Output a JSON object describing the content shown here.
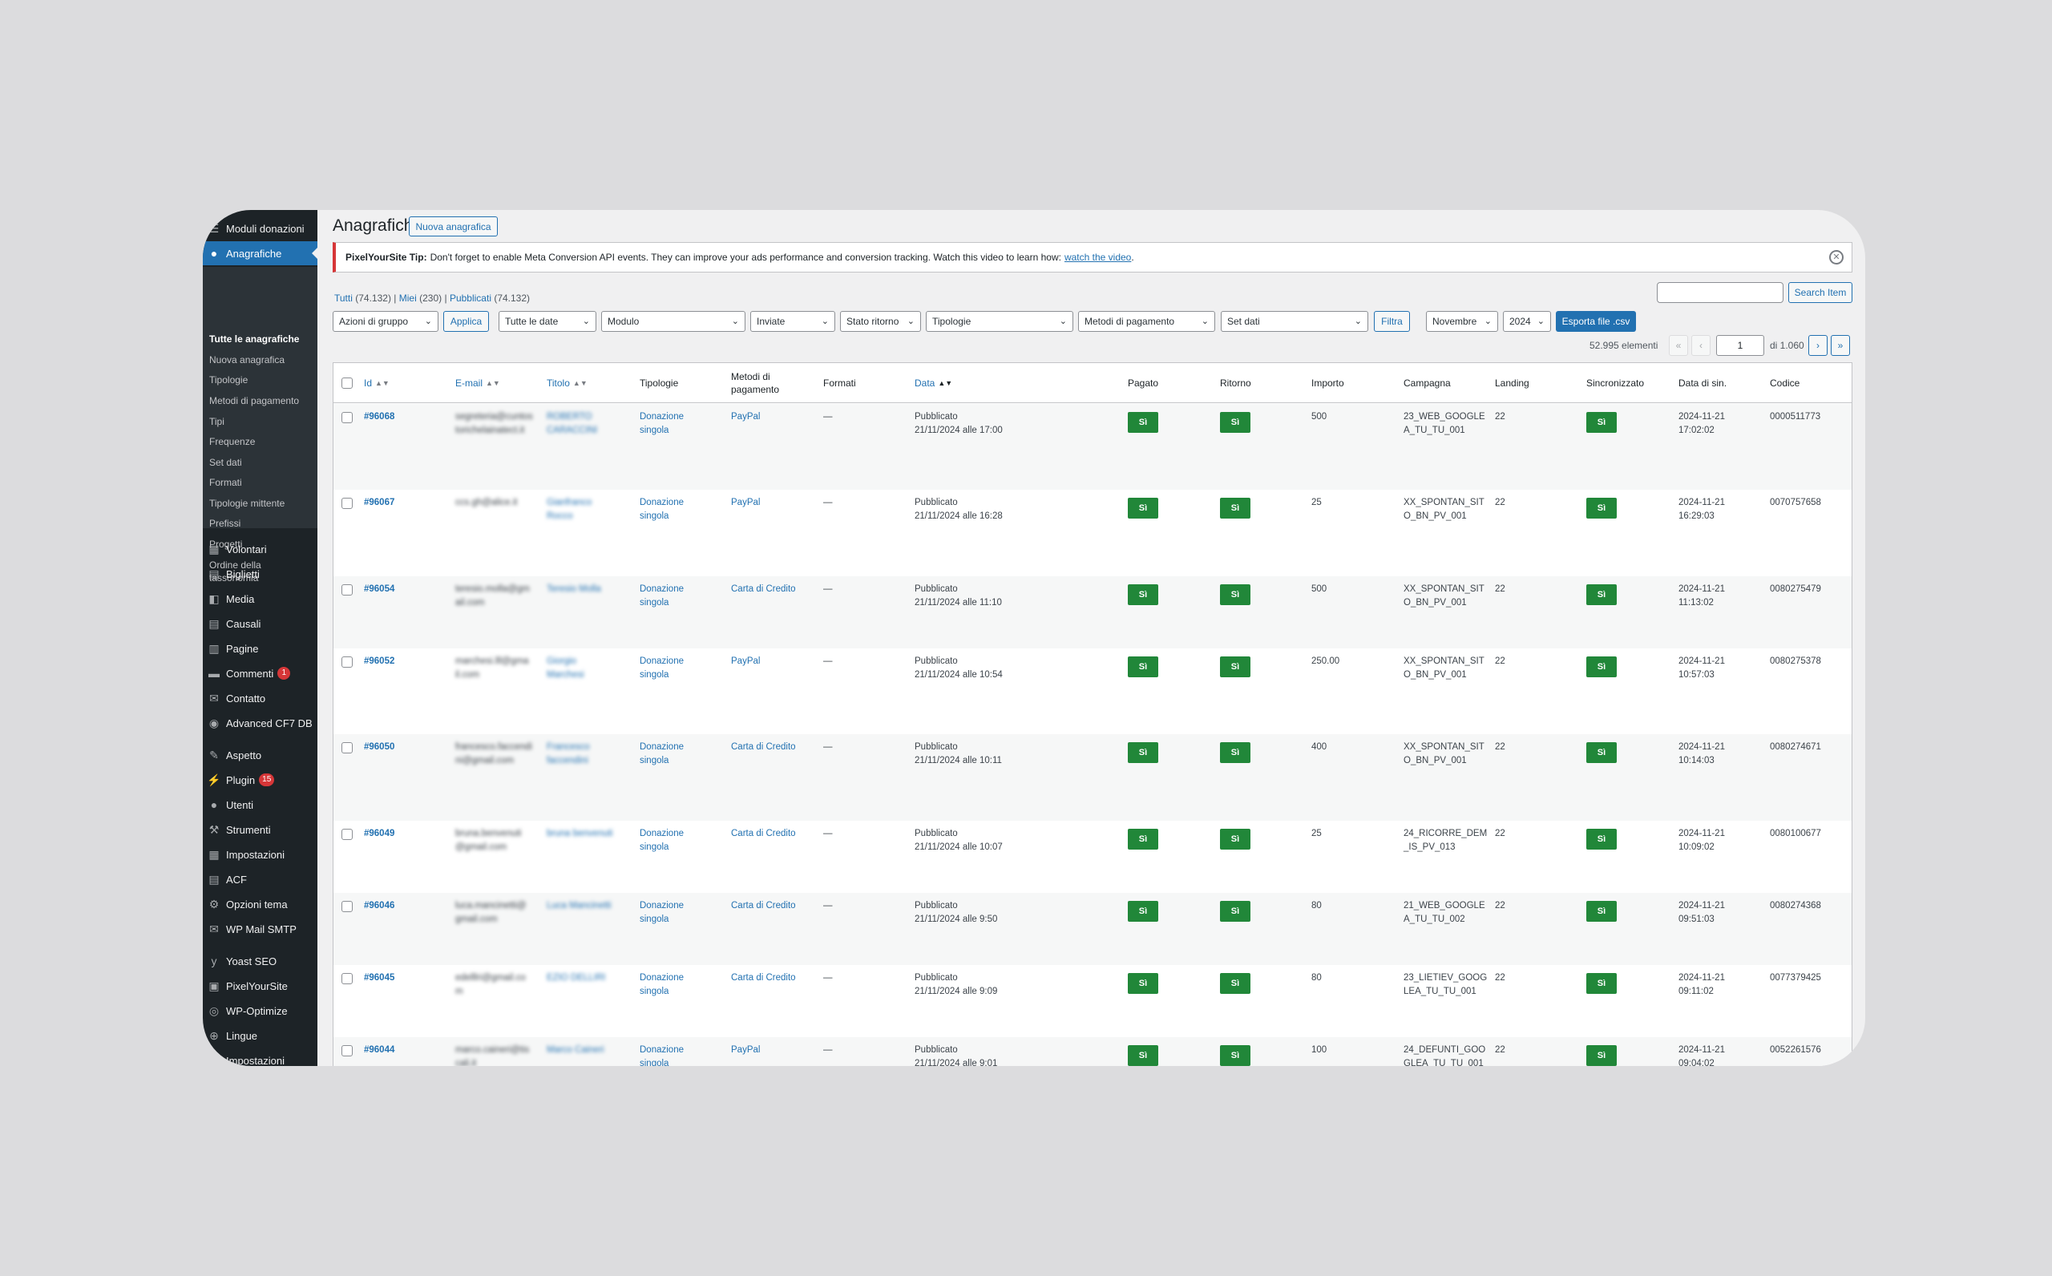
{
  "sidebar": {
    "top_item": "Moduli donazioni",
    "active_item": "Anagrafiche",
    "submenu": [
      "Tutte le anagrafiche",
      "Nuova anagrafica",
      "Tipologie",
      "Metodi di pagamento",
      "Tipi",
      "Frequenze",
      "Set dati",
      "Formati",
      "Tipologie mittente",
      "Prefissi",
      "Progetti",
      "Ordine della",
      "tassonomia"
    ],
    "items": [
      "Volontari",
      "Biglietti",
      "Media",
      "Causali",
      "Pagine",
      "Commenti",
      "Contatto",
      "Advanced CF7 DB",
      "Aspetto",
      "Plugin",
      "Utenti",
      "Strumenti",
      "Impostazioni",
      "ACF",
      "Opzioni tema",
      "WP Mail SMTP",
      "Yoast SEO",
      "PixelYourSite",
      "WP-Optimize",
      "Lingue",
      "Impostazioni"
    ],
    "badges": {
      "comments": "1",
      "plugins": "15"
    }
  },
  "header": {
    "title": "Anagrafiche",
    "new_button": "Nuova anagrafica"
  },
  "notice": {
    "brand": "PixelYourSite Tip:",
    "text": "Don't forget to enable Meta Conversion API events. They can improve your ads performance and conversion tracking. Watch this video to learn how:",
    "link": "watch the video",
    "period": "."
  },
  "views": {
    "all": "Tutti",
    "all_count": "(74.132)",
    "mine": "Miei",
    "mine_count": "(230)",
    "published": "Pubblicati",
    "published_count": "(74.132)",
    "sep": "|"
  },
  "search": {
    "button": "Search Item",
    "value": ""
  },
  "filters": {
    "bulk": "Azioni di gruppo",
    "apply": "Applica",
    "dates": "Tutte le date",
    "module": "Modulo",
    "sent": "Inviate",
    "return_status": "Stato ritorno",
    "types": "Tipologie",
    "payment_methods": "Metodi di pagamento",
    "dataset": "Set dati",
    "filter": "Filtra",
    "month": "Novembre",
    "year": "2024",
    "export": "Esporta file .csv"
  },
  "pagination": {
    "items": "52.995 elementi",
    "first": "«",
    "prev": "‹",
    "current": "1",
    "of": "di 1.060",
    "next": "›",
    "last": "»"
  },
  "columns": {
    "id": "Id",
    "email": "E-mail",
    "title": "Titolo",
    "types": "Tipologie",
    "payment1": "Metodi di",
    "payment2": "pagamento",
    "formats": "Formati",
    "date": "Data",
    "paid": "Pagato",
    "return": "Ritorno",
    "amount": "Importo",
    "campaign": "Campagna",
    "landing": "Landing",
    "synced": "Sincronizzato",
    "sync_date": "Data di sin.",
    "code": "Codice"
  },
  "rows": [
    {
      "id": "#96068",
      "email1": "segreteria@cuntos",
      "email2": "torichelainatect.it",
      "title1": "ROBERTO",
      "title2": "CARACCINI",
      "type1": "Donazione",
      "type2": "singola",
      "payment": "PayPal",
      "formats": "—",
      "status": "Pubblicato",
      "date": "21/11/2024 alle 17:00",
      "paid": "Sì",
      "ret": "Sì",
      "amount": "500",
      "camp1": "23_WEB_GOOGLE",
      "camp2": "A_TU_TU_001",
      "landing": "22",
      "synced": "Sì",
      "sd1": "2024-11-21",
      "sd2": "17:02:02",
      "code": "0000511773"
    },
    {
      "id": "#96067",
      "email1": "ccs.gh@alice.it",
      "email2": "",
      "title1": "Gianfranco",
      "title2": "Rocco",
      "type1": "Donazione",
      "type2": "singola",
      "payment": "PayPal",
      "formats": "—",
      "status": "Pubblicato",
      "date": "21/11/2024 alle 16:28",
      "paid": "Sì",
      "ret": "Sì",
      "amount": "25",
      "camp1": "XX_SPONTAN_SIT",
      "camp2": "O_BN_PV_001",
      "landing": "22",
      "synced": "Sì",
      "sd1": "2024-11-21",
      "sd2": "16:29:03",
      "code": "0070757658"
    },
    {
      "id": "#96054",
      "email1": "teresio.molla@gm",
      "email2": "ail.com",
      "title1": "Teresio Molla",
      "title2": "",
      "type1": "Donazione",
      "type2": "singola",
      "payment": "Carta di Credito",
      "formats": "—",
      "status": "Pubblicato",
      "date": "21/11/2024 alle 11:10",
      "paid": "Sì",
      "ret": "Sì",
      "amount": "500",
      "camp1": "XX_SPONTAN_SIT",
      "camp2": "O_BN_PV_001",
      "landing": "22",
      "synced": "Sì",
      "sd1": "2024-11-21",
      "sd2": "11:13:02",
      "code": "0080275479"
    },
    {
      "id": "#96052",
      "email1": "marchesi.lll@gma",
      "email2": "il.com",
      "title1": "Giorgio",
      "title2": "Marchesi",
      "type1": "Donazione",
      "type2": "singola",
      "payment": "PayPal",
      "formats": "—",
      "status": "Pubblicato",
      "date": "21/11/2024 alle 10:54",
      "paid": "Sì",
      "ret": "Sì",
      "amount": "250.00",
      "camp1": "XX_SPONTAN_SIT",
      "camp2": "O_BN_PV_001",
      "landing": "22",
      "synced": "Sì",
      "sd1": "2024-11-21",
      "sd2": "10:57:03",
      "code": "0080275378"
    },
    {
      "id": "#96050",
      "email1": "francesco.faccendi",
      "email2": "ni@gmail.com",
      "title1": "Francesco",
      "title2": "faccendini",
      "type1": "Donazione",
      "type2": "singola",
      "payment": "Carta di Credito",
      "formats": "—",
      "status": "Pubblicato",
      "date": "21/11/2024 alle 10:11",
      "paid": "Sì",
      "ret": "Sì",
      "amount": "400",
      "camp1": "XX_SPONTAN_SIT",
      "camp2": "O_BN_PV_001",
      "landing": "22",
      "synced": "Sì",
      "sd1": "2024-11-21",
      "sd2": "10:14:03",
      "code": "0080274671"
    },
    {
      "id": "#96049",
      "email1": "bruna.benvenuti",
      "email2": "@gmail.com",
      "title1": "bruna benvenuti",
      "title2": "",
      "type1": "Donazione",
      "type2": "singola",
      "payment": "Carta di Credito",
      "formats": "—",
      "status": "Pubblicato",
      "date": "21/11/2024 alle 10:07",
      "paid": "Sì",
      "ret": "Sì",
      "amount": "25",
      "camp1": "24_RICORRE_DEM",
      "camp2": "_IS_PV_013",
      "landing": "22",
      "synced": "Sì",
      "sd1": "2024-11-21",
      "sd2": "10:09:02",
      "code": "0080100677"
    },
    {
      "id": "#96046",
      "email1": "luca.mancinetti@",
      "email2": "gmail.com",
      "title1": "Luca Mancinetti",
      "title2": "",
      "type1": "Donazione",
      "type2": "singola",
      "payment": "Carta di Credito",
      "formats": "—",
      "status": "Pubblicato",
      "date": "21/11/2024 alle 9:50",
      "paid": "Sì",
      "ret": "Sì",
      "amount": "80",
      "camp1": "21_WEB_GOOGLE",
      "camp2": "A_TU_TU_002",
      "landing": "22",
      "synced": "Sì",
      "sd1": "2024-11-21",
      "sd2": "09:51:03",
      "code": "0080274368"
    },
    {
      "id": "#96045",
      "email1": "edelllri@gmail.co",
      "email2": "m",
      "title1": "EZIO DELLIRI",
      "title2": "",
      "type1": "Donazione",
      "type2": "singola",
      "payment": "Carta di Credito",
      "formats": "—",
      "status": "Pubblicato",
      "date": "21/11/2024 alle 9:09",
      "paid": "Sì",
      "ret": "Sì",
      "amount": "80",
      "camp1": "23_LIETIEV_GOOG",
      "camp2": "LEA_TU_TU_001",
      "landing": "22",
      "synced": "Sì",
      "sd1": "2024-11-21",
      "sd2": "09:11:02",
      "code": "0077379425"
    },
    {
      "id": "#96044",
      "email1": "marco.caineri@tis",
      "email2": "cali.it",
      "title1": "Marco Caineri",
      "title2": "",
      "type1": "Donazione",
      "type2": "singola",
      "payment": "PayPal",
      "formats": "—",
      "status": "Pubblicato",
      "date": "21/11/2024 alle 9:01",
      "paid": "Sì",
      "ret": "Sì",
      "amount": "100",
      "camp1": "24_DEFUNTI_GOO",
      "camp2": "GLEA_TU_TU_001",
      "landing": "22",
      "synced": "Sì",
      "sd1": "2024-11-21",
      "sd2": "09:04:02",
      "code": "0052261576"
    }
  ]
}
